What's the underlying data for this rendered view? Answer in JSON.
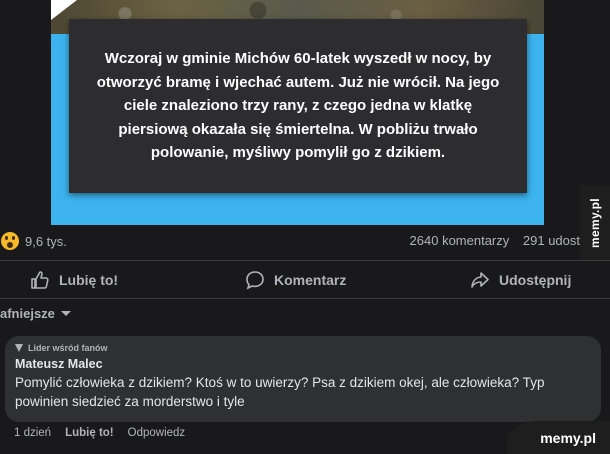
{
  "post": {
    "caption": "Wczoraj w gminie Michów 60-latek wyszedł w nocy, by otworzyć bramę i wjechać autem. Już nie wrócił. Na jego ciele znaleziono trzy rany, z czego jedna w klatkę piersiową okazała się śmiertelna. W pobliżu trwało polowanie, myśliwy pomylił go z dzikiem."
  },
  "reactions": {
    "icon": "wow-reaction-icon",
    "count": "9,6 tys.",
    "comments": "2640 komentarzy",
    "shares": "291 udost"
  },
  "actions": {
    "like": "Lubię to!",
    "comment": "Komentarz",
    "share": "Udostępnij"
  },
  "sort": {
    "label": "afniejsze"
  },
  "comment": {
    "badge": "Lider wśród fanów",
    "author": "Mateusz Malec",
    "text": "Pomylić człowieka z dzikiem? Ktoś w to uwierzy? Psa z dzikiem okej, ale człowieka? Typ powinien siedzieć za morderstwo i tyle",
    "time": "1 dzień",
    "like": "Lubię to!",
    "reply": "Odpowiedz"
  },
  "watermark": {
    "side": "memy.pl",
    "bottom": "memy.pl"
  },
  "colors": {
    "background": "#19191b",
    "image_border": "#3cb3ee",
    "caption_box": "#2d2d30",
    "comment_bubble": "#2f3031",
    "wow": "#f7b928"
  }
}
